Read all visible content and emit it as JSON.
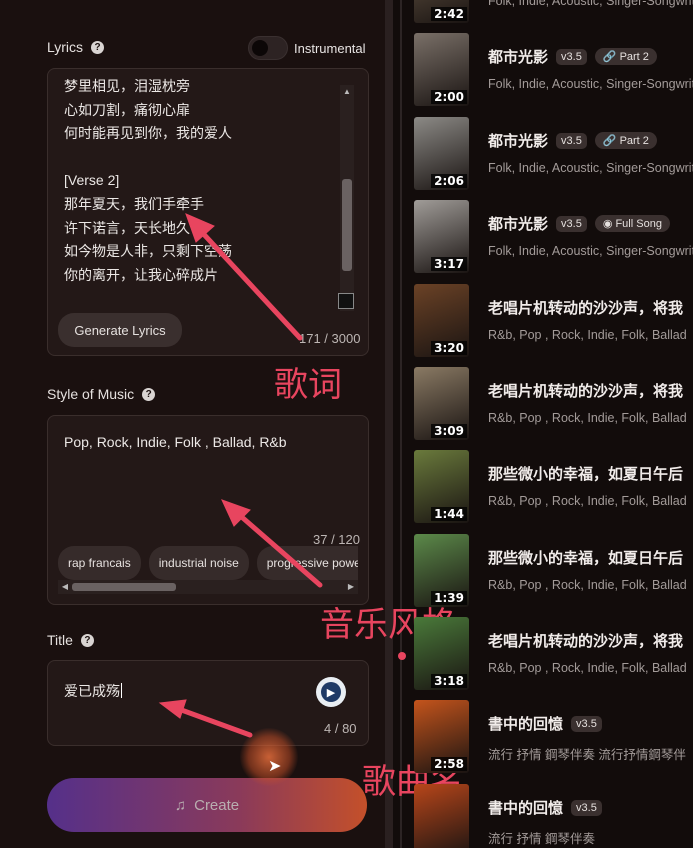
{
  "lyrics": {
    "label": "Lyrics",
    "help": "?",
    "instrumental_label": "Instrumental",
    "text": "梦里相见，泪湿枕旁\n心如刀割，痛彻心扉\n何时能再见到你，我的爱人\n\n[Verse 2]\n那年夏天，我们手牵手\n许下诺言，天长地久\n如今物是人非，只剩下空荡\n你的离开，让我心碎成片",
    "generate_button": "Generate Lyrics",
    "counter": "171 / 3000"
  },
  "style": {
    "label": "Style of Music",
    "help": "?",
    "value": "Pop,  Rock, Indie, Folk , Ballad, R&b",
    "counter": "37 / 120",
    "chips": [
      "rap francais",
      "industrial noise",
      "progressive power"
    ]
  },
  "title": {
    "label": "Title",
    "help": "?",
    "value": "爱已成殇",
    "counter": "4 / 80"
  },
  "create_button": "Create",
  "annotations": {
    "lyrics": "歌词",
    "style": "音乐风格",
    "title": "歌曲名"
  },
  "songs": [
    {
      "title": "",
      "tags": "Folk, Indie, Acoustic, Singer-Songwriter",
      "duration": "2:42",
      "version": "",
      "part": "",
      "thumb": "#6a5a48"
    },
    {
      "title": "都市光影",
      "tags": "Folk, Indie, Acoustic, Singer-Songwriter",
      "duration": "2:00",
      "version": "v3.5",
      "part": "Part 2",
      "thumb": "#7a7068"
    },
    {
      "title": "都市光影",
      "tags": "Folk, Indie, Acoustic, Singer-Songwriter",
      "duration": "2:06",
      "version": "v3.5",
      "part": "Part 2",
      "thumb": "#8c8a86"
    },
    {
      "title": "都市光影",
      "tags": "Folk, Indie, Acoustic, Singer-Songwriter",
      "duration": "3:17",
      "version": "v3.5",
      "part": "Full Song",
      "thumb": "#a09c98"
    },
    {
      "title": "老唱片机转动的沙沙声，将我",
      "tags": "R&b, Pop , Rock, Indie, Folk, Ballad",
      "duration": "3:20",
      "version": "",
      "part": "",
      "thumb": "#6b4226"
    },
    {
      "title": "老唱片机转动的沙沙声，将我",
      "tags": "R&b, Pop , Rock, Indie, Folk, Ballad",
      "duration": "3:09",
      "version": "",
      "part": "",
      "thumb": "#8a7a64"
    },
    {
      "title": "那些微小的幸福，如夏日午后",
      "tags": "R&b, Pop , Rock, Indie, Folk, Ballad",
      "duration": "1:44",
      "version": "",
      "part": "",
      "thumb": "#6a7a3c"
    },
    {
      "title": "那些微小的幸福，如夏日午后",
      "tags": "R&b, Pop , Rock, Indie, Folk, Ballad",
      "duration": "1:39",
      "version": "",
      "part": "",
      "thumb": "#5c8a4a"
    },
    {
      "title": "老唱片机转动的沙沙声，将我",
      "tags": "R&b, Pop , Rock, Indie, Folk, Ballad",
      "duration": "3:18",
      "version": "",
      "part": "",
      "thumb": "#4a7a3a"
    },
    {
      "title": "書中的回憶",
      "tags": "流行 抒情 鋼琴伴奏 流行抒情鋼琴伴",
      "duration": "2:58",
      "version": "v3.5",
      "part": "",
      "thumb": "#c4541c"
    },
    {
      "title": "書中的回憶",
      "tags": "流行 抒情 鋼琴伴奏",
      "duration": "",
      "version": "v3.5",
      "part": "",
      "thumb": "#b8461a"
    }
  ]
}
